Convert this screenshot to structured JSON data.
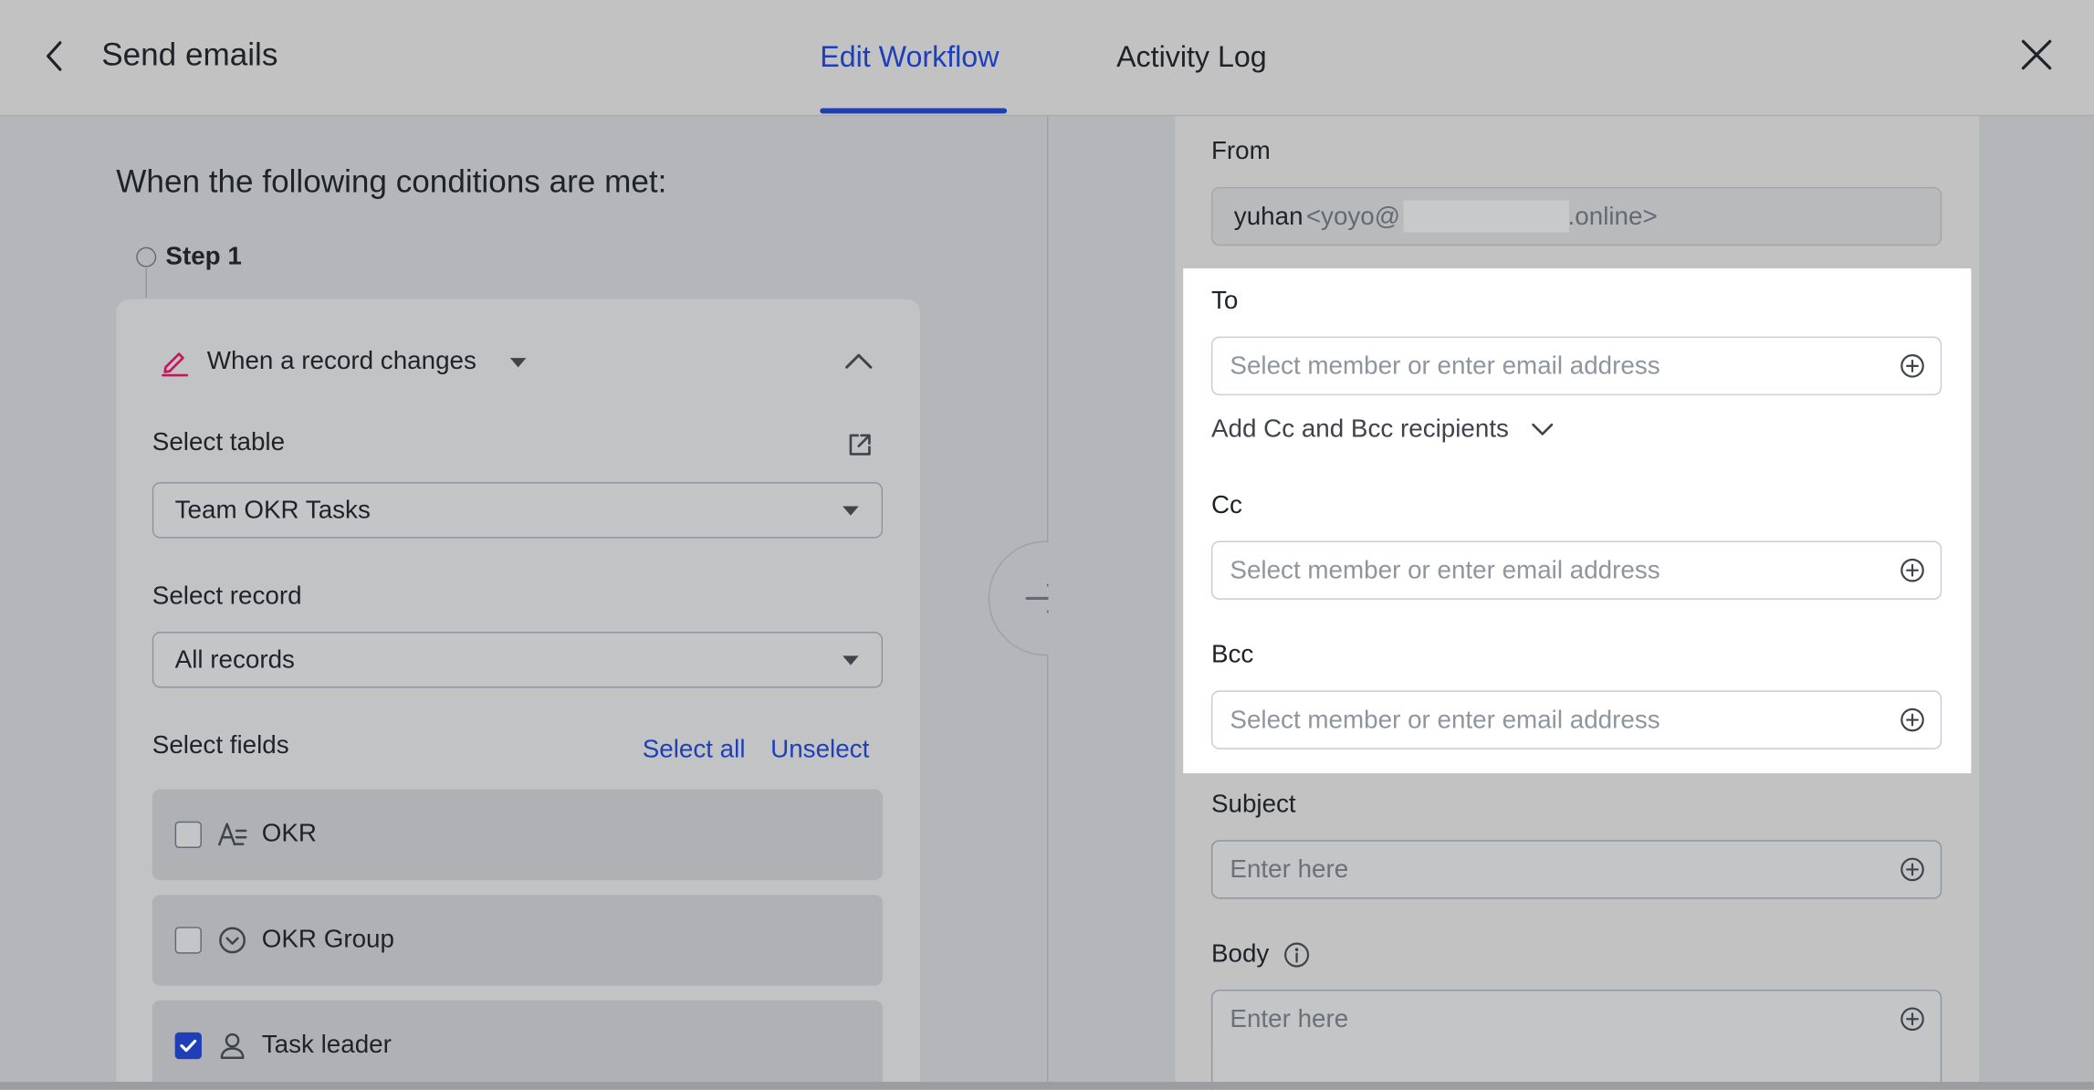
{
  "header": {
    "back_icon": "chevron-left-icon",
    "title": "Send emails",
    "tabs": [
      {
        "label": "Edit Workflow",
        "active": true
      },
      {
        "label": "Activity Log",
        "active": false
      }
    ],
    "close_icon": "close-icon",
    "accent_color": "#1e3fb8"
  },
  "left": {
    "heading": "When the following conditions are met:",
    "step_label": "Step 1",
    "trigger": {
      "icon": "pencil-icon",
      "label": "When a record changes",
      "select_table_label": "Select table",
      "table_value": "Team OKR Tasks",
      "select_record_label": "Select record",
      "record_value": "All records",
      "select_fields_label": "Select fields",
      "select_all": "Select all",
      "unselect": "Unselect",
      "fields": [
        {
          "name": "OKR",
          "icon": "text-field-icon",
          "checked": false
        },
        {
          "name": "OKR Group",
          "icon": "single-select-icon",
          "checked": false
        },
        {
          "name": "Task leader",
          "icon": "person-icon",
          "checked": true
        }
      ]
    }
  },
  "right": {
    "from_label": "From",
    "from_name": "yuhan",
    "from_email_start": "<yoyo@",
    "from_email_end": ".online>",
    "to_label": "To",
    "to_placeholder": "Select member or enter email address",
    "add_cc_bcc": "Add Cc and Bcc recipients",
    "cc_label": "Cc",
    "cc_placeholder": "Select member or enter email address",
    "bcc_label": "Bcc",
    "bcc_placeholder": "Select member or enter email address",
    "subject_label": "Subject",
    "subject_placeholder": "Enter here",
    "body_label": "Body",
    "body_placeholder": "Enter here"
  }
}
